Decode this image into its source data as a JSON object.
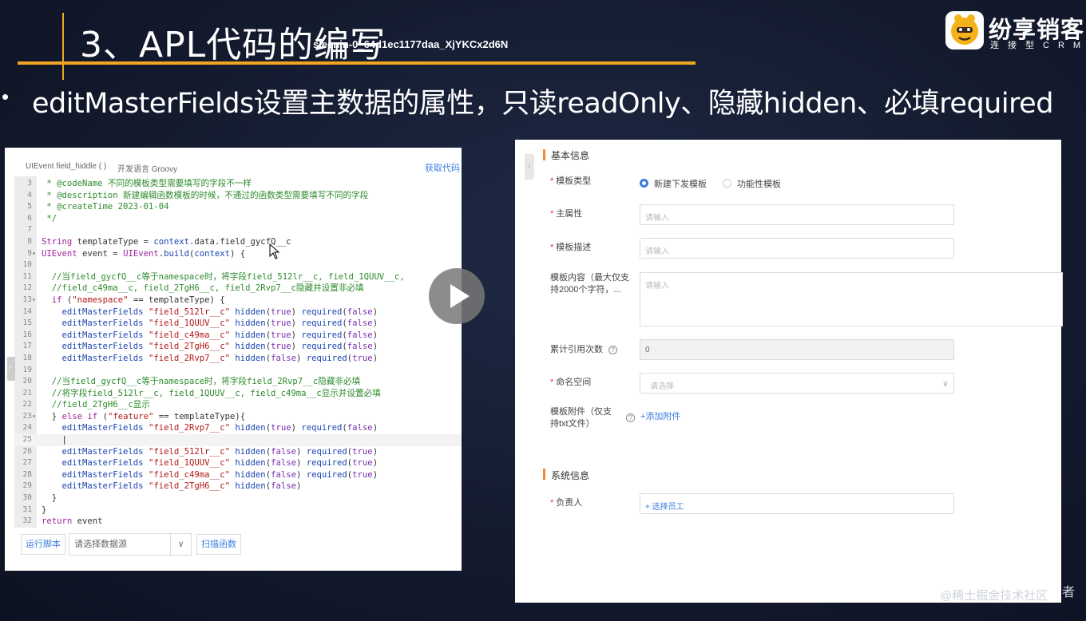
{
  "slide": {
    "title": "3、APL代码的编写",
    "watermark_id": "sleenin-0_64d1ec1177daa_XjYKCx2d6N",
    "brand_name": "纷享销客",
    "brand_sub": "连接型CRM",
    "bullet": "•",
    "bullet_text": "editMasterFields设置主数据的属性，只读readOnly、隐藏hidden、必填required",
    "credit": "@稀土掘金技术社区",
    "credit_tail": "者"
  },
  "editor": {
    "title": "UIEvent field_hiddle ( )",
    "language": "开发语言 Groovy",
    "fetch_code": "获取代码",
    "run_button": "运行脚本",
    "datasource_placeholder": "请选择数据源",
    "datasource_arrow": "∨",
    "scan_button": "扫描函数",
    "lines": [
      {
        "n": "3",
        "f": "",
        "cls": "cm",
        "t": " * @codeName 不同的模板类型需要填写的字段不一样"
      },
      {
        "n": "4",
        "f": "",
        "cls": "cm",
        "t": " * @description 新建编辑函数模板的时候，不通过的函数类型需要填写不同的字段"
      },
      {
        "n": "5",
        "f": "",
        "cls": "cm",
        "t": " * @createTime 2023-01-04"
      },
      {
        "n": "6",
        "f": "",
        "cls": "cm",
        "t": " */"
      },
      {
        "n": "7",
        "f": "",
        "cls": "",
        "t": ""
      },
      {
        "n": "8",
        "f": "",
        "cls": "mix1",
        "t": "String templateType = context.data.field_gycfQ__c"
      },
      {
        "n": "9",
        "f": "▾",
        "cls": "mix2",
        "t": "UIEvent event = UIEvent.build(context) {"
      },
      {
        "n": "10",
        "f": "",
        "cls": "",
        "t": ""
      },
      {
        "n": "11",
        "f": "",
        "cls": "cm",
        "t": "  //当field_gycfQ__c等于namespace时，将字段field_512lr__c, field_1QUUV__c,"
      },
      {
        "n": "12",
        "f": "",
        "cls": "cm",
        "t": "  //field_c49ma__c, field_2TgH6__c, field_2Rvp7__c隐藏并设置非必填"
      },
      {
        "n": "13",
        "f": "▾",
        "cls": "if1",
        "t": "  if (\"namespace\" == templateType) {"
      },
      {
        "n": "14",
        "f": "",
        "cls": "emf",
        "t": "    editMasterFields \"field_512lr__c\" hidden(true) required(false)"
      },
      {
        "n": "15",
        "f": "",
        "cls": "emf",
        "t": "    editMasterFields \"field_1QUUV__c\" hidden(true) required(false)"
      },
      {
        "n": "16",
        "f": "",
        "cls": "emf",
        "t": "    editMasterFields \"field_c49ma__c\" hidden(true) required(false)"
      },
      {
        "n": "17",
        "f": "",
        "cls": "emf",
        "t": "    editMasterFields \"field_2TgH6__c\" hidden(true) required(false)"
      },
      {
        "n": "18",
        "f": "",
        "cls": "emf",
        "t": "    editMasterFields \"field_2Rvp7__c\" hidden(false) required(true)"
      },
      {
        "n": "19",
        "f": "",
        "cls": "",
        "t": ""
      },
      {
        "n": "20",
        "f": "",
        "cls": "cm",
        "t": "  //当field_gycfQ__c等于namespace时，将字段field_2Rvp7__c隐藏非必填"
      },
      {
        "n": "21",
        "f": "",
        "cls": "cm",
        "t": "  //将字段field_512lr__c, field_1QUUV__c, field_c49ma__c显示并设置必填"
      },
      {
        "n": "22",
        "f": "",
        "cls": "cm",
        "t": "  //field_2TgH6__c显示"
      },
      {
        "n": "23",
        "f": "▾",
        "cls": "if2",
        "t": "  } else if (\"feature\" == templateType){"
      },
      {
        "n": "24",
        "f": "",
        "cls": "emf",
        "t": "    editMasterFields \"field_2Rvp7__c\" hidden(true) required(false)"
      },
      {
        "n": "25",
        "f": "",
        "cls": "cur",
        "t": "    |"
      },
      {
        "n": "26",
        "f": "",
        "cls": "emf",
        "t": "    editMasterFields \"field_512lr__c\" hidden(false) required(true)"
      },
      {
        "n": "27",
        "f": "",
        "cls": "emf",
        "t": "    editMasterFields \"field_1QUUV__c\" hidden(false) required(true)"
      },
      {
        "n": "28",
        "f": "",
        "cls": "emf",
        "t": "    editMasterFields \"field_c49ma__c\" hidden(false) required(true)"
      },
      {
        "n": "29",
        "f": "",
        "cls": "emf",
        "t": "    editMasterFields \"field_2TgH6__c\" hidden(false)"
      },
      {
        "n": "30",
        "f": "",
        "cls": "",
        "t": "  }"
      },
      {
        "n": "31",
        "f": "",
        "cls": "",
        "t": "}"
      },
      {
        "n": "32",
        "f": "",
        "cls": "ret",
        "t": "return event"
      }
    ]
  },
  "form": {
    "collapse_icon": "‹",
    "section_basic": "基本信息",
    "template_type_label": "模板类型",
    "radio_new": "新建下发模板",
    "radio_func": "功能性模板",
    "main_attr_label": "主属性",
    "main_attr_placeholder": "请输入",
    "desc_label": "模板描述",
    "desc_placeholder": "请输入",
    "content_label_1": "模板内容（最大仅支",
    "content_label_2": "持2000个字符，...",
    "content_placeholder": "请输入",
    "ref_count_label": "累计引用次数",
    "ref_count_value": "0",
    "namespace_label": "命名空间",
    "namespace_placeholder": "请选择",
    "attach_label_1": "模板附件（仅支",
    "attach_label_2": "持txt文件）",
    "attach_link": "+添加附件",
    "section_system": "系统信息",
    "owner_label": "负责人",
    "owner_link": "+ 选择员工",
    "required_mark": "*",
    "help_mark": "?",
    "chevron": "∨"
  },
  "colors": {
    "accent_orange": "#f0a622",
    "link_blue": "#3a7ee0",
    "required_red": "#e33"
  }
}
